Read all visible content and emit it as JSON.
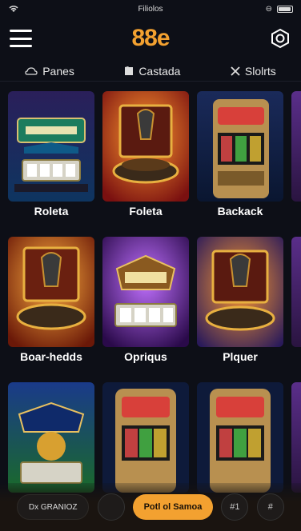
{
  "status_bar": {
    "title": "Filiolos"
  },
  "header": {
    "logo": "88e"
  },
  "tabs": [
    {
      "label": "Panes",
      "icon": "cloud-icon"
    },
    {
      "label": "Castada",
      "icon": "card-icon"
    },
    {
      "label": "Slolrts",
      "icon": "close-icon"
    }
  ],
  "games": [
    {
      "label": "Roleta",
      "theme": "slot-blue"
    },
    {
      "label": "Foleta",
      "theme": "roulette-red"
    },
    {
      "label": "Backack",
      "theme": "slot-machine"
    },
    {
      "label": "Boar-hedds",
      "theme": "roulette-orange"
    },
    {
      "label": "Opriqus",
      "theme": "slot-purple"
    },
    {
      "label": "Plquer",
      "theme": "roulette-purple"
    },
    {
      "label": "",
      "theme": "slot-green"
    },
    {
      "label": "",
      "theme": "slot-machine"
    },
    {
      "label": "",
      "theme": "slot-machine"
    }
  ],
  "bottom_bar": {
    "left_label": "Dx GRANIOZ",
    "cta_label": "Potl ol Samoa",
    "right_1": "#1",
    "right_2": "#"
  },
  "colors": {
    "accent": "#f3a130",
    "background": "#0d0f17"
  }
}
